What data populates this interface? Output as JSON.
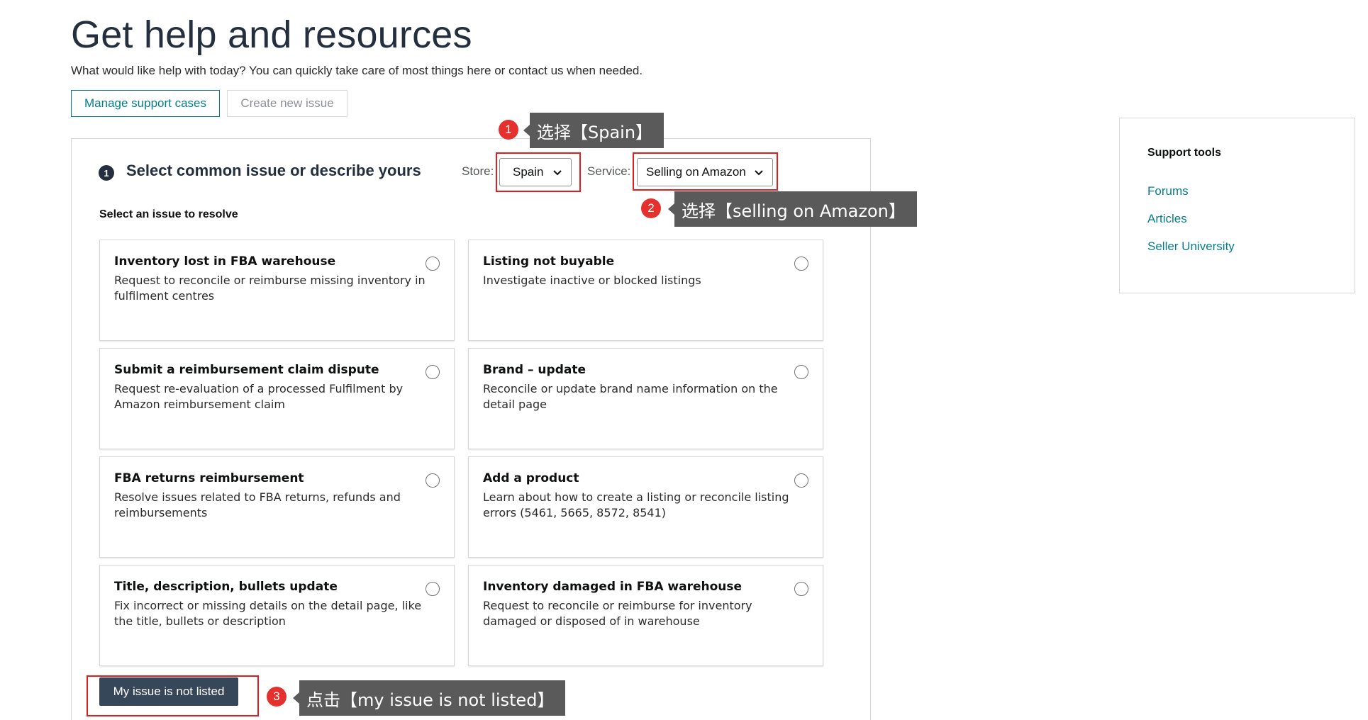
{
  "header": {
    "title": "Get help and resources",
    "subtitle": "What would like help with today? You can quickly take care of most things here or contact us when needed.",
    "manage_cases": "Manage support cases",
    "create_issue": "Create new issue"
  },
  "section": {
    "step_number": "1",
    "title": "Select common issue or describe yours",
    "store_label": "Store:",
    "store_value": "Spain",
    "service_label": "Service:",
    "service_value": "Selling on Amazon",
    "issue_prompt": "Select an issue to resolve"
  },
  "issues": [
    {
      "title": "Inventory lost in FBA warehouse",
      "desc": "Request to reconcile or reimburse missing inventory in fulfilment centres"
    },
    {
      "title": "Listing not buyable",
      "desc": "Investigate inactive or blocked listings"
    },
    {
      "title": "Submit a reimbursement claim dispute",
      "desc": "Request re-evaluation of a processed Fulfilment by Amazon reimbursement claim"
    },
    {
      "title": "Brand – update",
      "desc": "Reconcile or update brand name information on the detail page"
    },
    {
      "title": "FBA returns reimbursement",
      "desc": "Resolve issues related to FBA returns, refunds and reimbursements"
    },
    {
      "title": "Add a product",
      "desc": "Learn about how to create a listing or reconcile listing errors (5461, 5665, 8572, 8541)"
    },
    {
      "title": "Title, description, bullets update",
      "desc": "Fix incorrect or missing details on the detail page, like the title, bullets or description"
    },
    {
      "title": "Inventory damaged in FBA warehouse",
      "desc": "Request to reconcile or reimburse for inventory damaged or disposed of in warehouse"
    }
  ],
  "not_listed_label": "My issue is not listed",
  "support_tools": {
    "title": "Support tools",
    "links": [
      "Forums",
      "Articles",
      "Seller University"
    ]
  },
  "annotations": [
    {
      "number": "1",
      "text": "选择【Spain】"
    },
    {
      "number": "2",
      "text": "选择【selling on Amazon】"
    },
    {
      "number": "3",
      "text": "点击【my issue is not listed】"
    }
  ],
  "colors": {
    "accent_teal": "#067d8c",
    "dark_button": "#37475a",
    "annotation_red": "#e11d1d",
    "callout_gray": "#5a5a5a"
  }
}
